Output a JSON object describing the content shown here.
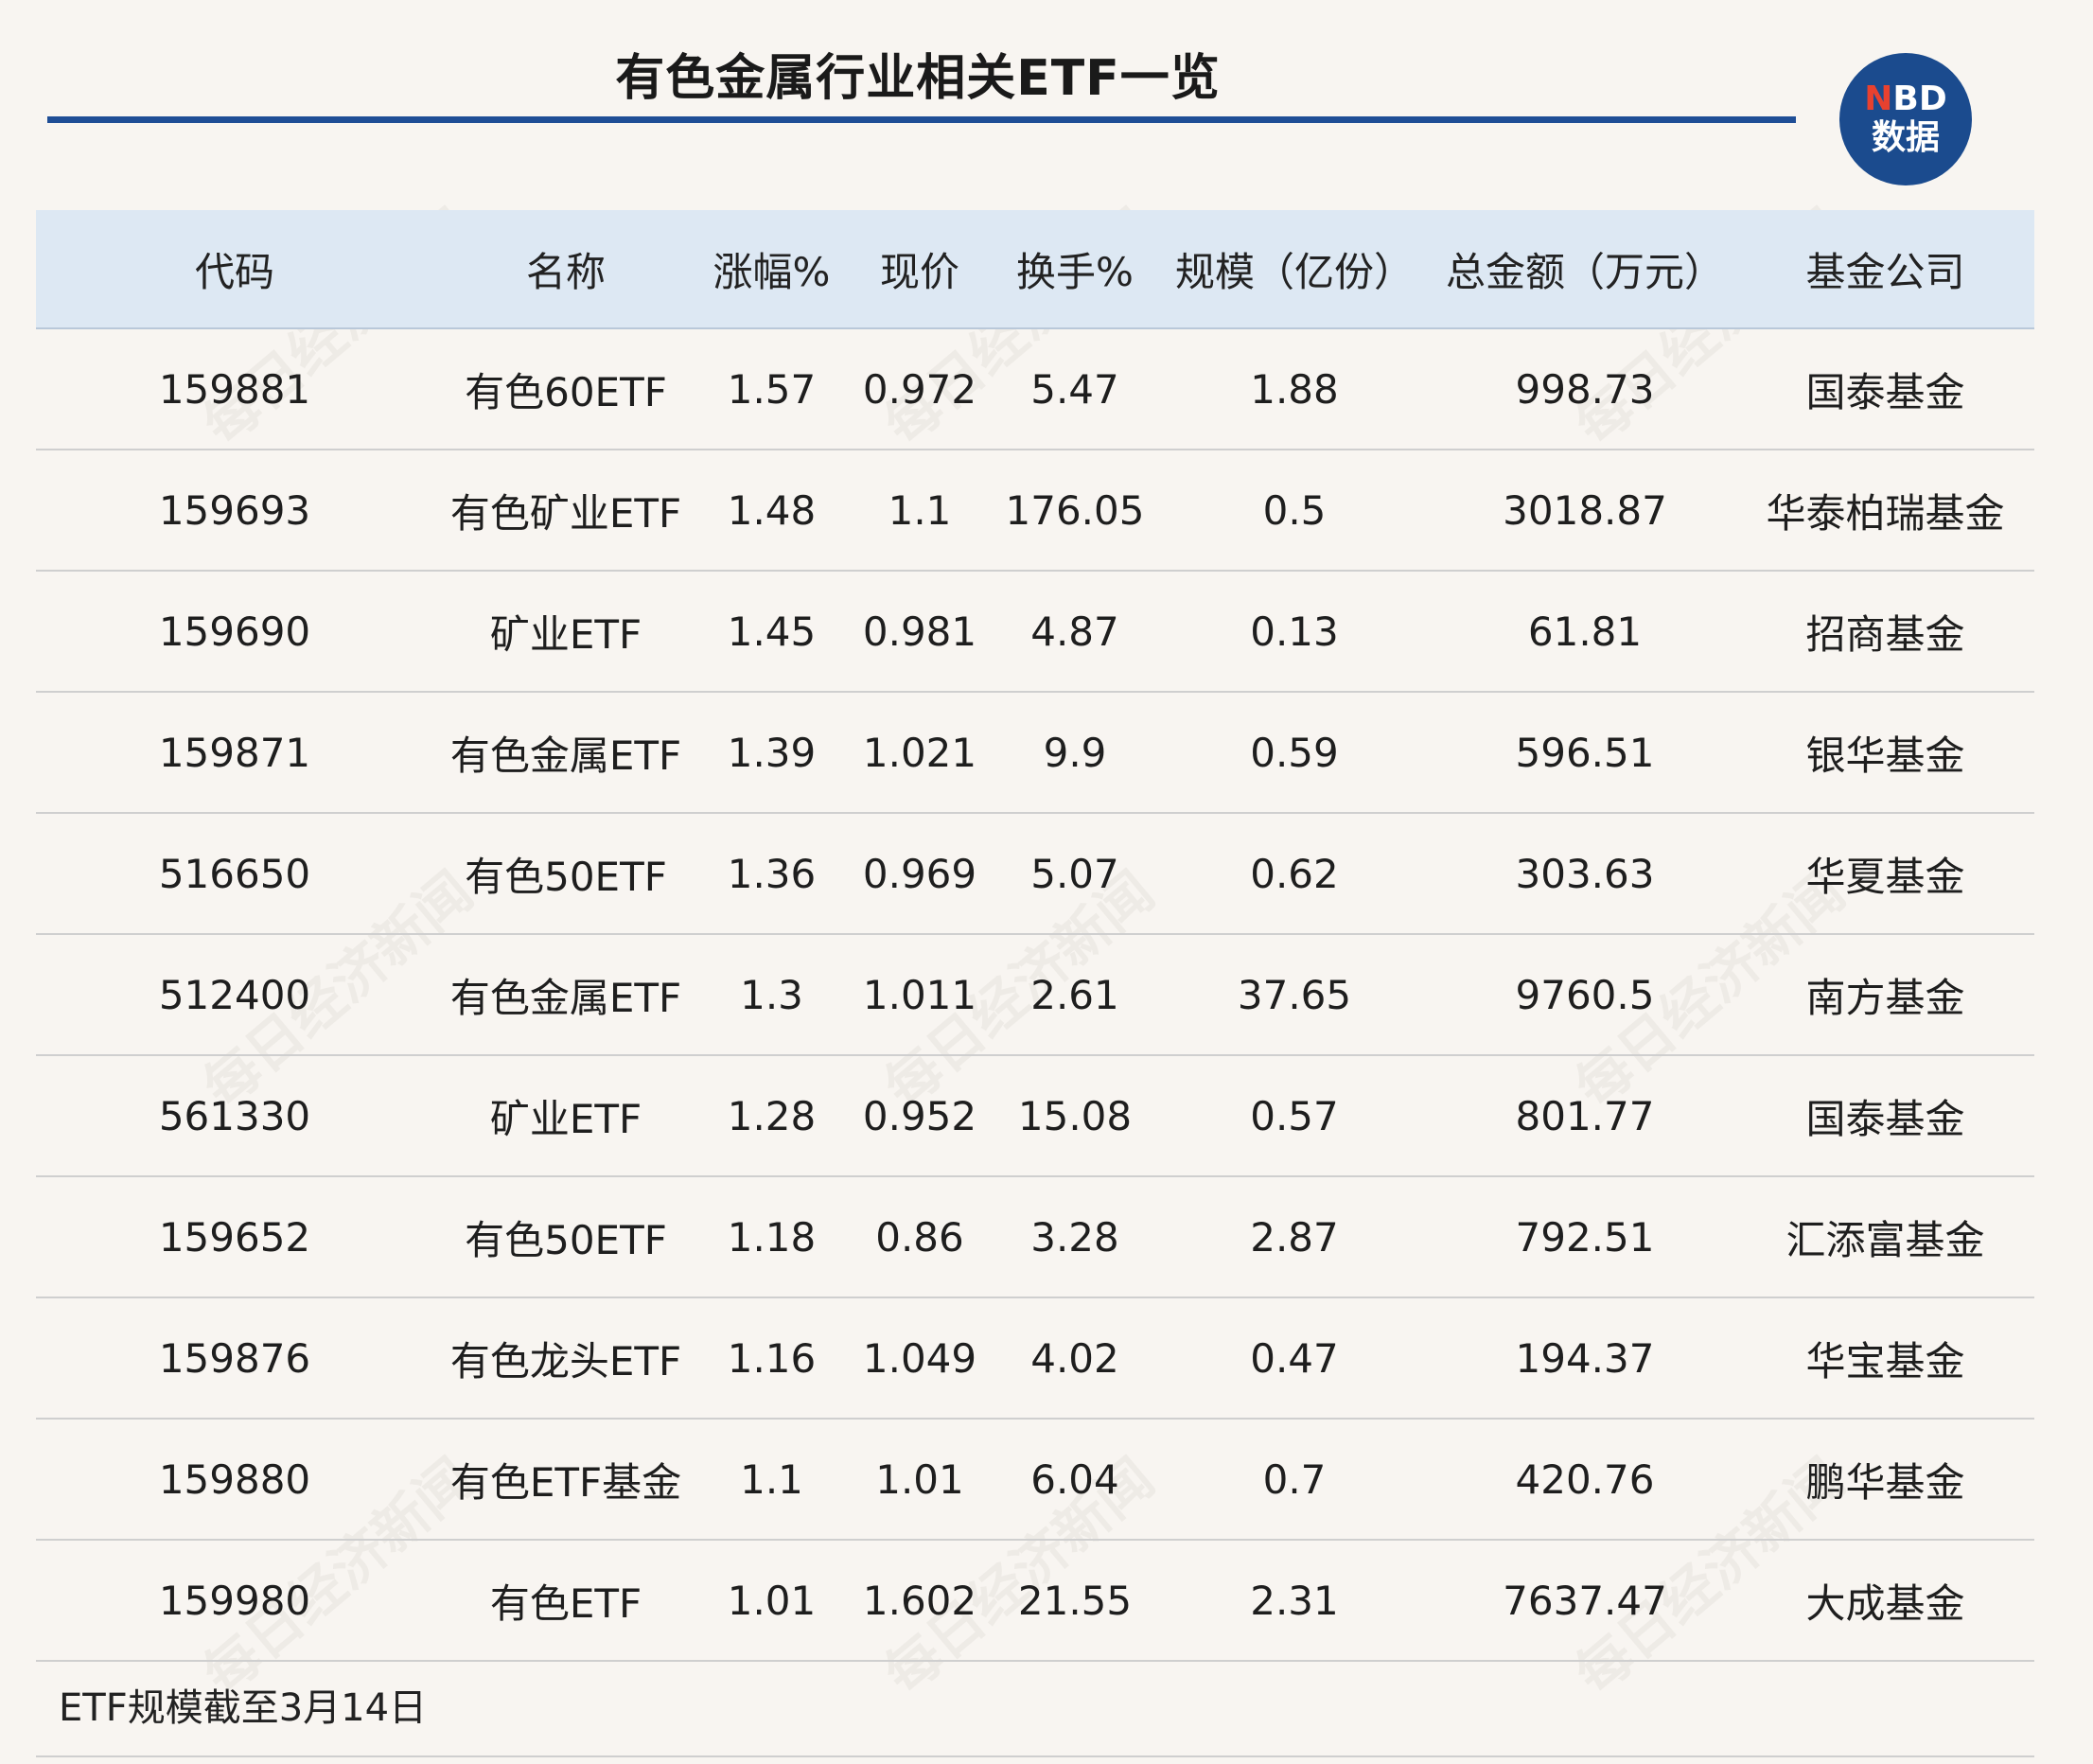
{
  "title": "有色金属行业相关ETF一览",
  "logo": {
    "line1_n": "N",
    "line1_rest": "BD",
    "line2": "数据"
  },
  "watermark": "每日经济新闻",
  "table": {
    "headers": [
      "代码",
      "名称",
      "涨幅%",
      "现价",
      "换手%",
      "规模（亿份）",
      "总金额（万元）",
      "基金公司"
    ],
    "rows": [
      [
        "159881",
        "有色60ETF",
        "1.57",
        "0.972",
        "5.47",
        "1.88",
        "998.73",
        "国泰基金"
      ],
      [
        "159693",
        "有色矿业ETF",
        "1.48",
        "1.1",
        "176.05",
        "0.5",
        "3018.87",
        "华泰柏瑞基金"
      ],
      [
        "159690",
        "矿业ETF",
        "1.45",
        "0.981",
        "4.87",
        "0.13",
        "61.81",
        "招商基金"
      ],
      [
        "159871",
        "有色金属ETF",
        "1.39",
        "1.021",
        "9.9",
        "0.59",
        "596.51",
        "银华基金"
      ],
      [
        "516650",
        "有色50ETF",
        "1.36",
        "0.969",
        "5.07",
        "0.62",
        "303.63",
        "华夏基金"
      ],
      [
        "512400",
        "有色金属ETF",
        "1.3",
        "1.011",
        "2.61",
        "37.65",
        "9760.5",
        "南方基金"
      ],
      [
        "561330",
        "矿业ETF",
        "1.28",
        "0.952",
        "15.08",
        "0.57",
        "801.77",
        "国泰基金"
      ],
      [
        "159652",
        "有色50ETF",
        "1.18",
        "0.86",
        "3.28",
        "2.87",
        "792.51",
        "汇添富基金"
      ],
      [
        "159876",
        "有色龙头ETF",
        "1.16",
        "1.049",
        "4.02",
        "0.47",
        "194.37",
        "华宝基金"
      ],
      [
        "159880",
        "有色ETF基金",
        "1.1",
        "1.01",
        "6.04",
        "0.7",
        "420.76",
        "鹏华基金"
      ],
      [
        "159980",
        "有色ETF",
        "1.01",
        "1.602",
        "21.55",
        "2.31",
        "7637.47",
        "大成基金"
      ]
    ]
  },
  "note": "ETF规模截至3月14日",
  "colors": {
    "header_bg": "#dde8f3",
    "rule": "#1f4e96",
    "logo_bg": "#1b4b8e",
    "logo_accent": "#e8412f"
  }
}
